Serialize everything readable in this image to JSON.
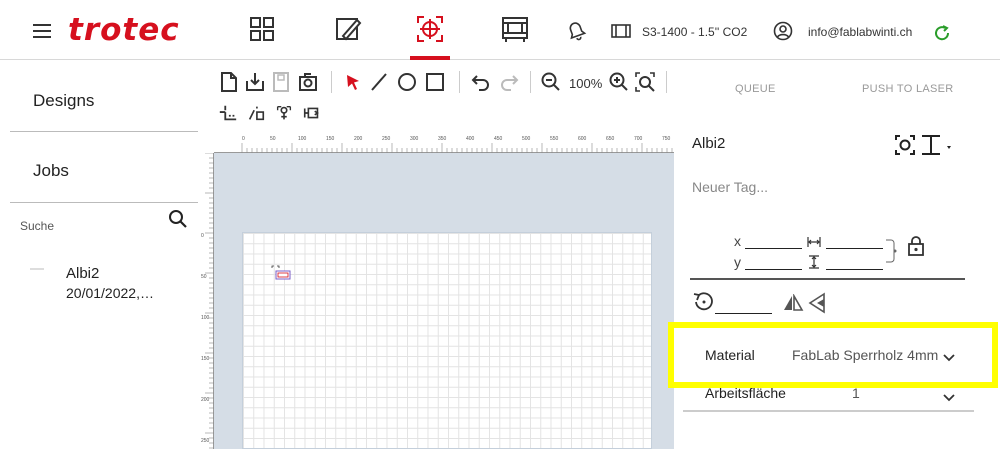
{
  "topbar": {
    "logo": "trotec",
    "machine": "S3-1400 - 1.5'' CO2",
    "user": "info@fablabwinti.ch",
    "nav_icons": [
      "designs-icon",
      "edit-icon",
      "laser-target-icon",
      "machine-table-icon"
    ]
  },
  "toolbar": {
    "zoom": "100%"
  },
  "ruler": {
    "top_ticks": [
      "0",
      "50",
      "100",
      "150",
      "200",
      "250",
      "300",
      "350",
      "400",
      "450",
      "500",
      "550",
      "600",
      "650",
      "700",
      "750"
    ],
    "left_ticks": [
      "0",
      "50",
      "100",
      "150",
      "200",
      "250"
    ]
  },
  "left": {
    "designs_label": "Designs",
    "jobs_label": "Jobs",
    "search_placeholder": "Suche",
    "job": {
      "name": "Albi2",
      "date": "20/01/2022,…"
    }
  },
  "right": {
    "tab_queue": "QUEUE",
    "tab_push": "PUSH TO LASER",
    "job_name": "Albi2",
    "tag_placeholder": "Neuer Tag...",
    "x_label": "x",
    "y_label": "y",
    "material_label": "Material",
    "material_value": "FabLab Sperrholz 4mm",
    "workspace_label": "Arbeitsfläche",
    "workspace_value": "1"
  },
  "colors": {
    "brand": "#d6101e",
    "highlight": "#ffff00",
    "canvas_bg": "#d5dde6"
  }
}
